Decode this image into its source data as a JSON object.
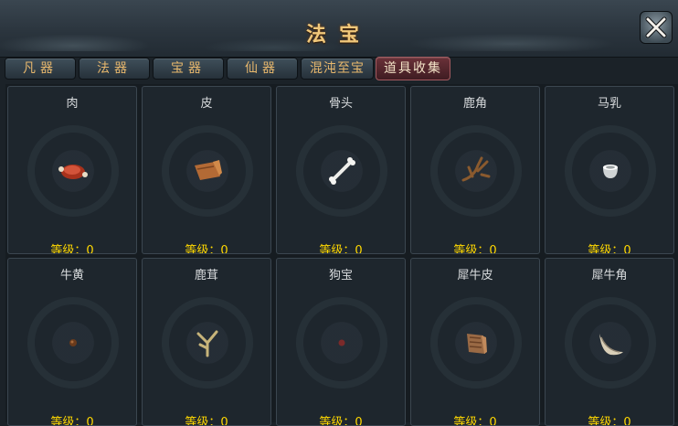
{
  "window": {
    "title": "法宝"
  },
  "tabs": [
    {
      "label": "凡器",
      "active": false
    },
    {
      "label": "法器",
      "active": false
    },
    {
      "label": "宝器",
      "active": false
    },
    {
      "label": "仙器",
      "active": false
    },
    {
      "label": "混沌至宝",
      "active": false
    },
    {
      "label": "道具收集",
      "active": true
    }
  ],
  "items": [
    {
      "name": "肉",
      "level_text": "等级：0",
      "icon": "meat-icon"
    },
    {
      "name": "皮",
      "level_text": "等级：0",
      "icon": "hide-scroll-icon"
    },
    {
      "name": "骨头",
      "level_text": "等级：0",
      "icon": "bone-icon"
    },
    {
      "name": "鹿角",
      "level_text": "等级：0",
      "icon": "antler-icon"
    },
    {
      "name": "马乳",
      "level_text": "等级：0",
      "icon": "milk-bowl-icon"
    },
    {
      "name": "牛黄",
      "level_text": "等级：0",
      "icon": "bezoar-icon"
    },
    {
      "name": "鹿茸",
      "level_text": "等级：0",
      "icon": "velvet-antler-icon"
    },
    {
      "name": "狗宝",
      "level_text": "等级：0",
      "icon": "dog-bezoar-icon"
    },
    {
      "name": "犀牛皮",
      "level_text": "等级：0",
      "icon": "rhino-hide-icon"
    },
    {
      "name": "犀牛角",
      "level_text": "等级：0",
      "icon": "rhino-horn-icon"
    }
  ],
  "colors": {
    "title": "#f0c77a",
    "level": "#ffd800",
    "active_tab": "#6a3138"
  }
}
